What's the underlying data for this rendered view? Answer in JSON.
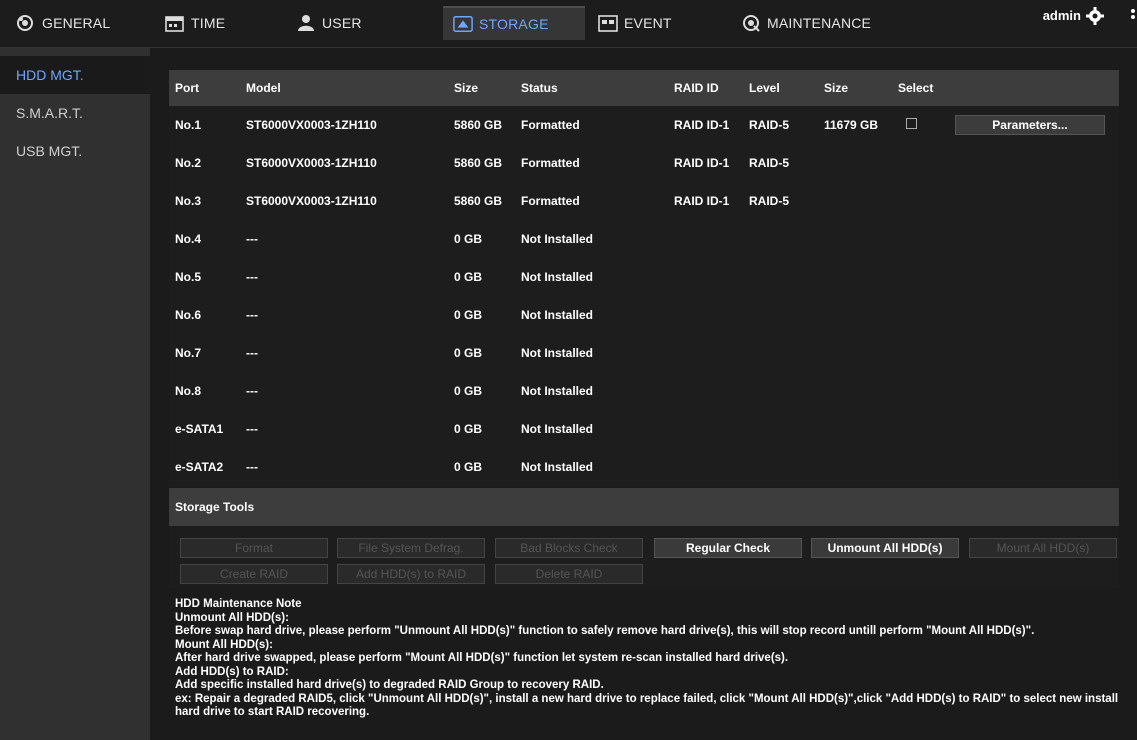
{
  "nav": {
    "tabs": [
      {
        "label": "GENERAL",
        "icon": "general-icon"
      },
      {
        "label": "TIME",
        "icon": "calendar-icon"
      },
      {
        "label": "USER",
        "icon": "user-icon"
      },
      {
        "label": "STORAGE",
        "icon": "storage-icon"
      },
      {
        "label": "EVENT",
        "icon": "event-icon"
      },
      {
        "label": "MAINTENANCE",
        "icon": "maintenance-icon"
      }
    ],
    "active": "STORAGE",
    "user": "admin"
  },
  "sidebar": {
    "items": [
      {
        "label": "HDD MGT."
      },
      {
        "label": "S.M.A.R.T."
      },
      {
        "label": "USB MGT."
      }
    ]
  },
  "table": {
    "headers": {
      "port": "Port",
      "model": "Model",
      "size": "Size",
      "status": "Status",
      "raid_id": "RAID ID",
      "level": "Level",
      "raid_size": "Size",
      "select": "Select"
    },
    "rows": [
      {
        "port": "No.1",
        "model": "ST6000VX0003-1ZH110",
        "size": "5860 GB",
        "status": "Formatted",
        "raid_id": "RAID ID-1",
        "level": "RAID-5",
        "raid_size": "11679 GB"
      },
      {
        "port": "No.2",
        "model": "ST6000VX0003-1ZH110",
        "size": "5860 GB",
        "status": "Formatted",
        "raid_id": "RAID ID-1",
        "level": "RAID-5",
        "raid_size": ""
      },
      {
        "port": "No.3",
        "model": "ST6000VX0003-1ZH110",
        "size": "5860 GB",
        "status": "Formatted",
        "raid_id": "RAID ID-1",
        "level": "RAID-5",
        "raid_size": ""
      },
      {
        "port": "No.4",
        "model": "---",
        "size": "0 GB",
        "status": "Not Installed",
        "raid_id": "",
        "level": "",
        "raid_size": ""
      },
      {
        "port": "No.5",
        "model": "---",
        "size": "0 GB",
        "status": "Not Installed",
        "raid_id": "",
        "level": "",
        "raid_size": ""
      },
      {
        "port": "No.6",
        "model": "---",
        "size": "0 GB",
        "status": "Not Installed",
        "raid_id": "",
        "level": "",
        "raid_size": ""
      },
      {
        "port": "No.7",
        "model": "---",
        "size": "0 GB",
        "status": "Not Installed",
        "raid_id": "",
        "level": "",
        "raid_size": ""
      },
      {
        "port": "No.8",
        "model": "---",
        "size": "0 GB",
        "status": "Not Installed",
        "raid_id": "",
        "level": "",
        "raid_size": ""
      },
      {
        "port": "e-SATA1",
        "model": "---",
        "size": "0 GB",
        "status": "Not Installed",
        "raid_id": "",
        "level": "",
        "raid_size": ""
      },
      {
        "port": "e-SATA2",
        "model": "---",
        "size": "0 GB",
        "status": "Not Installed",
        "raid_id": "",
        "level": "",
        "raid_size": ""
      }
    ],
    "parameters_label": "Parameters..."
  },
  "tools": {
    "title": "Storage Tools",
    "buttons": [
      {
        "label": "Format",
        "enabled": false
      },
      {
        "label": "File System Defrag.",
        "enabled": false
      },
      {
        "label": "Bad Blocks Check",
        "enabled": false
      },
      {
        "label": "Regular Check",
        "enabled": true
      },
      {
        "label": "Unmount All HDD(s)",
        "enabled": true
      },
      {
        "label": "Mount All HDD(s)",
        "enabled": false
      },
      {
        "label": "Create RAID",
        "enabled": false
      },
      {
        "label": "Add HDD(s) to RAID",
        "enabled": false
      },
      {
        "label": "Delete RAID",
        "enabled": false
      }
    ]
  },
  "note": {
    "lines": [
      "HDD Maintenance Note",
      "Unmount All HDD(s):",
      "Before swap hard drive, please perform \"Unmount All HDD(s)\" function to safely remove hard drive(s), this will stop record untill perform \"Mount All HDD(s)\".",
      "Mount All HDD(s):",
      "After hard drive swapped, please perform \"Mount All HDD(s)\" function let system re-scan installed hard drive(s).",
      "Add HDD(s) to RAID:",
      "Add specific installed hard drive(s) to degraded RAID Group to recovery RAID.",
      "ex: Repair a degraded RAID5, click \"Unmount All HDD(s)\", install a new hard drive to replace failed, click \"Mount All HDD(s)\",click \"Add HDD(s) to RAID\" to select new install hard drive to start RAID recovering."
    ]
  }
}
